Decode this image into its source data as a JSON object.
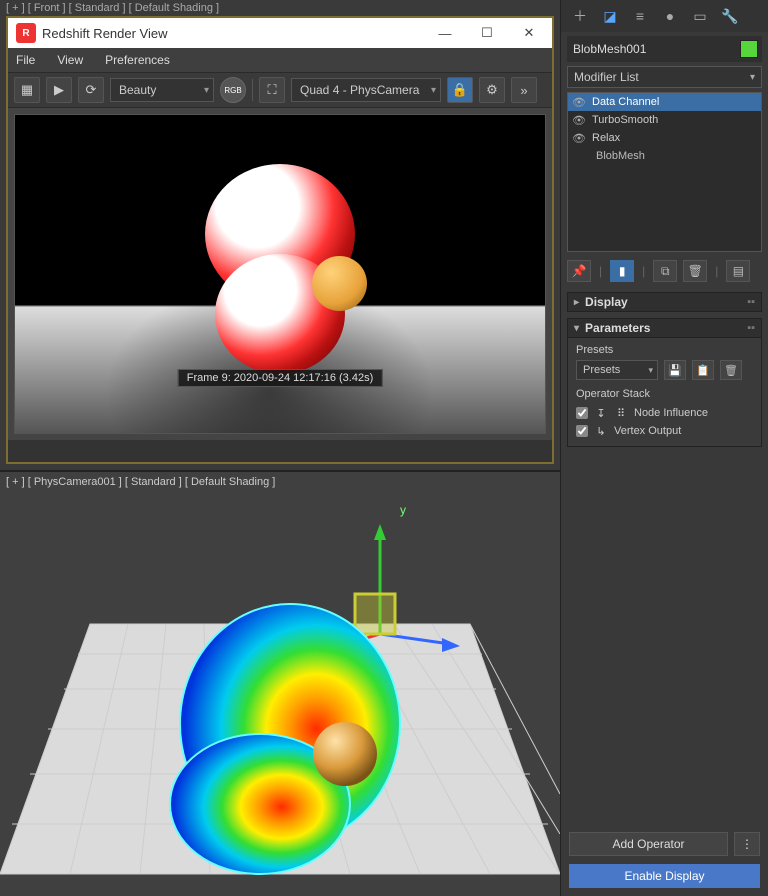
{
  "viewport_top_label": "[ + ] [ Front ] [ Standard ] [ Default Shading ]",
  "viewport_bottom_label": "[ + ] [ PhysCamera001 ] [ Standard ] [ Default Shading ]",
  "render_window": {
    "title": "Redshift Render View",
    "menu": {
      "file": "File",
      "view": "View",
      "preferences": "Preferences"
    },
    "toolbar": {
      "slate_icon": "▦",
      "play_icon": "▶",
      "refresh_icon": "⟳",
      "pass_select": "Beauty",
      "rgb_label": "RGB",
      "crop_icon": "⛶",
      "camera_select": "Quad 4 - PhysCamera",
      "lock_icon": "🔒",
      "cog_icon": "⚙",
      "more_icon": "»"
    },
    "status_text": "Frame 9: 2020-09-24 12:17:16 (3.42s)"
  },
  "command_panel": {
    "object_name": "BlobMesh001",
    "modifier_list_label": "Modifier List",
    "stack": {
      "item0": "Data Channel",
      "item1": "TurboSmooth",
      "item2": "Relax",
      "base": "BlobMesh"
    },
    "pin_icon": "📌",
    "rollouts": {
      "display": "Display",
      "parameters": "Parameters"
    },
    "presets": {
      "label": "Presets",
      "select": "Presets"
    },
    "operator_stack": {
      "label": "Operator Stack",
      "op0": "Node Influence",
      "op1": "Vertex Output"
    },
    "buttons": {
      "add_operator": "Add Operator",
      "enable_display": "Enable Display"
    }
  }
}
